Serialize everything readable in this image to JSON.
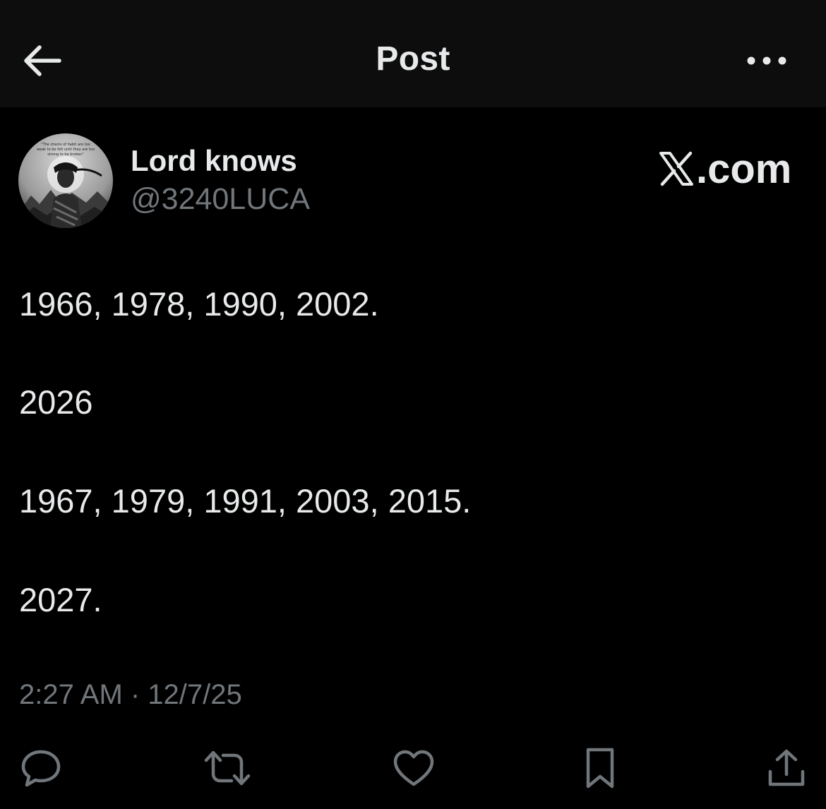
{
  "header": {
    "title": "Post",
    "back_icon": "arrow-left-icon",
    "more_icon": "more-horizontal-icon"
  },
  "author": {
    "display_name": "Lord knows",
    "handle": "@3240LUCA",
    "avatar_caption": "\"The chains of habit are too weak to be felt until they are too strong to be broken\""
  },
  "brand": {
    "suffix": ".com",
    "logo_icon": "x-logo-icon"
  },
  "post": {
    "lines": [
      "1966, 1978, 1990, 2002.",
      "2026",
      "1967, 1979, 1991, 2003, 2015.",
      "2027."
    ],
    "timestamp": "2:27 AM · 12/7/25"
  },
  "actions": [
    {
      "icon": "reply-icon"
    },
    {
      "icon": "repost-icon"
    },
    {
      "icon": "like-icon"
    },
    {
      "icon": "bookmark-icon"
    },
    {
      "icon": "share-icon"
    }
  ],
  "colors": {
    "background": "#000000",
    "header_background": "#0d0d0d",
    "primary_text": "#e7e9ea",
    "secondary_text": "#71767b",
    "icon": "#71767b"
  }
}
